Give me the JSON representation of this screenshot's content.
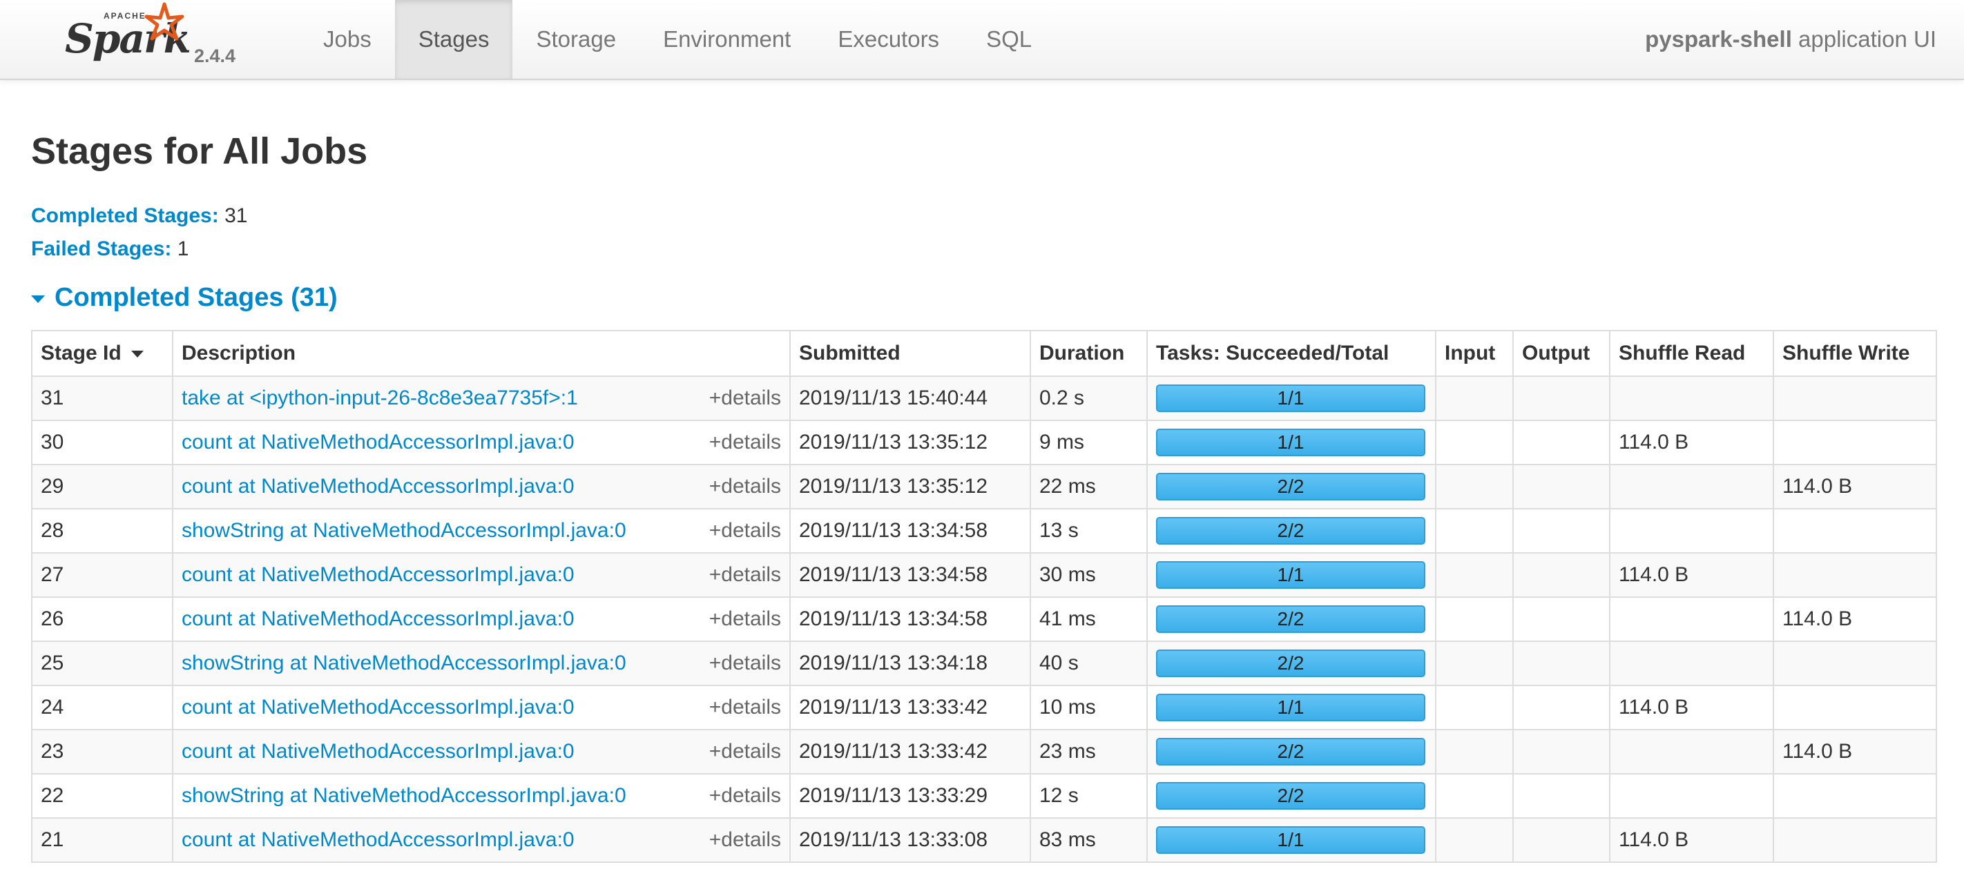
{
  "header": {
    "logo_apache": "APACHE",
    "logo_spark": "Spark",
    "version": "2.4.4",
    "tabs": [
      {
        "label": "Jobs",
        "active": false
      },
      {
        "label": "Stages",
        "active": true
      },
      {
        "label": "Storage",
        "active": false
      },
      {
        "label": "Environment",
        "active": false
      },
      {
        "label": "Executors",
        "active": false
      },
      {
        "label": "SQL",
        "active": false
      }
    ],
    "app_name": "pyspark-shell",
    "app_suffix": " application UI"
  },
  "page": {
    "title": "Stages for All Jobs",
    "completed_label": "Completed Stages:",
    "completed_count": "31",
    "failed_label": "Failed Stages:",
    "failed_count": "1",
    "section_title": "Completed Stages (31)"
  },
  "table": {
    "columns": [
      "Stage Id",
      "Description",
      "Submitted",
      "Duration",
      "Tasks: Succeeded/Total",
      "Input",
      "Output",
      "Shuffle Read",
      "Shuffle Write"
    ],
    "details_label": "+details",
    "progress_color": "#3eaeea",
    "rows": [
      {
        "id": "31",
        "desc": "take at <ipython-input-26-8c8e3ea7735f>:1",
        "submitted": "2019/11/13 15:40:44",
        "duration": "0.2 s",
        "tasks": "1/1",
        "progress": 1.0,
        "input": "",
        "output": "",
        "shuffle_read": "",
        "shuffle_write": ""
      },
      {
        "id": "30",
        "desc": "count at NativeMethodAccessorImpl.java:0",
        "submitted": "2019/11/13 13:35:12",
        "duration": "9 ms",
        "tasks": "1/1",
        "progress": 1.0,
        "input": "",
        "output": "",
        "shuffle_read": "114.0 B",
        "shuffle_write": ""
      },
      {
        "id": "29",
        "desc": "count at NativeMethodAccessorImpl.java:0",
        "submitted": "2019/11/13 13:35:12",
        "duration": "22 ms",
        "tasks": "2/2",
        "progress": 1.0,
        "input": "",
        "output": "",
        "shuffle_read": "",
        "shuffle_write": "114.0 B"
      },
      {
        "id": "28",
        "desc": "showString at NativeMethodAccessorImpl.java:0",
        "submitted": "2019/11/13 13:34:58",
        "duration": "13 s",
        "tasks": "2/2",
        "progress": 1.0,
        "input": "",
        "output": "",
        "shuffle_read": "",
        "shuffle_write": ""
      },
      {
        "id": "27",
        "desc": "count at NativeMethodAccessorImpl.java:0",
        "submitted": "2019/11/13 13:34:58",
        "duration": "30 ms",
        "tasks": "1/1",
        "progress": 1.0,
        "input": "",
        "output": "",
        "shuffle_read": "114.0 B",
        "shuffle_write": ""
      },
      {
        "id": "26",
        "desc": "count at NativeMethodAccessorImpl.java:0",
        "submitted": "2019/11/13 13:34:58",
        "duration": "41 ms",
        "tasks": "2/2",
        "progress": 1.0,
        "input": "",
        "output": "",
        "shuffle_read": "",
        "shuffle_write": "114.0 B"
      },
      {
        "id": "25",
        "desc": "showString at NativeMethodAccessorImpl.java:0",
        "submitted": "2019/11/13 13:34:18",
        "duration": "40 s",
        "tasks": "2/2",
        "progress": 1.0,
        "input": "",
        "output": "",
        "shuffle_read": "",
        "shuffle_write": ""
      },
      {
        "id": "24",
        "desc": "count at NativeMethodAccessorImpl.java:0",
        "submitted": "2019/11/13 13:33:42",
        "duration": "10 ms",
        "tasks": "1/1",
        "progress": 1.0,
        "input": "",
        "output": "",
        "shuffle_read": "114.0 B",
        "shuffle_write": ""
      },
      {
        "id": "23",
        "desc": "count at NativeMethodAccessorImpl.java:0",
        "submitted": "2019/11/13 13:33:42",
        "duration": "23 ms",
        "tasks": "2/2",
        "progress": 1.0,
        "input": "",
        "output": "",
        "shuffle_read": "",
        "shuffle_write": "114.0 B"
      },
      {
        "id": "22",
        "desc": "showString at NativeMethodAccessorImpl.java:0",
        "submitted": "2019/11/13 13:33:29",
        "duration": "12 s",
        "tasks": "2/2",
        "progress": 1.0,
        "input": "",
        "output": "",
        "shuffle_read": "",
        "shuffle_write": ""
      },
      {
        "id": "21",
        "desc": "count at NativeMethodAccessorImpl.java:0",
        "submitted": "2019/11/13 13:33:08",
        "duration": "83 ms",
        "tasks": "1/1",
        "progress": 1.0,
        "input": "",
        "output": "",
        "shuffle_read": "114.0 B",
        "shuffle_write": ""
      }
    ]
  }
}
